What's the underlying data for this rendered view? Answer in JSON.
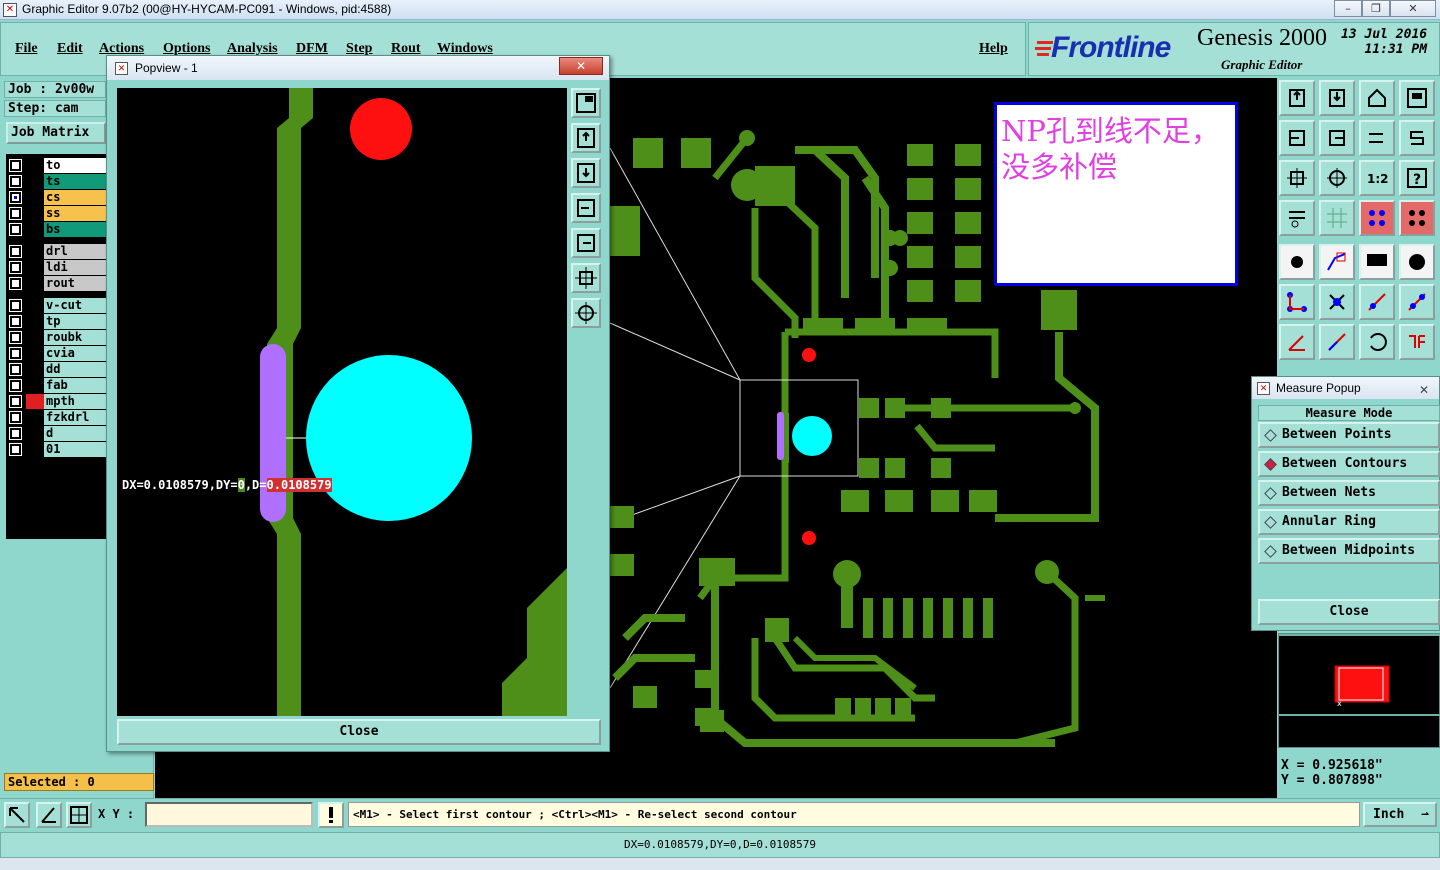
{
  "window": {
    "title": "Graphic Editor 9.07b2 (00@HY-HYCAM-PC091 - Windows, pid:4588)",
    "min_label": "–",
    "max_label": "❐",
    "close_label": "✕"
  },
  "menu": {
    "items": [
      "File",
      "Edit",
      "Actions",
      "Options",
      "Analysis",
      "DFM",
      "Step",
      "Rout",
      "Windows"
    ],
    "help": "Help"
  },
  "brand": {
    "logo": "Frontline",
    "product": "Genesis 2000",
    "subtitle": "Graphic Editor",
    "date": "13 Jul 2016",
    "time": "11:31 PM"
  },
  "job": {
    "job_label": "Job : 2v00w",
    "step_label": "Step: cam",
    "matrix_button": "Job Matrix"
  },
  "layers": [
    {
      "name": "to",
      "color": "#ffffff",
      "checked": false,
      "group": 0
    },
    {
      "name": "ts",
      "color": "#109a7a",
      "checked": false,
      "group": 0
    },
    {
      "name": "cs",
      "color": "#f6c24d",
      "checked": true,
      "group": 0
    },
    {
      "name": "ss",
      "color": "#f6c24d",
      "checked": false,
      "group": 0
    },
    {
      "name": "bs",
      "color": "#109a7a",
      "checked": false,
      "group": 0
    },
    {
      "name": "drl",
      "color": "#c8c8c8",
      "checked": false,
      "group": 1
    },
    {
      "name": "ldi",
      "color": "#c8c8c8",
      "checked": false,
      "group": 1
    },
    {
      "name": "rout",
      "color": "#c8c8c8",
      "checked": false,
      "group": 1
    },
    {
      "name": "v-cut",
      "color": "#a5e0d7",
      "checked": false,
      "group": 2
    },
    {
      "name": "tp",
      "color": "#a5e0d7",
      "checked": false,
      "group": 2
    },
    {
      "name": "roubk",
      "color": "#a5e0d7",
      "checked": false,
      "group": 2
    },
    {
      "name": "cvia",
      "color": "#a5e0d7",
      "checked": false,
      "group": 2
    },
    {
      "name": "dd",
      "color": "#a5e0d7",
      "checked": false,
      "group": 2
    },
    {
      "name": "fab",
      "color": "#a5e0d7",
      "checked": false,
      "group": 2
    },
    {
      "name": "mpth",
      "color": "#a5e0d7",
      "checked": false,
      "group": 2,
      "swatch": "#e02020"
    },
    {
      "name": "fzkdrl",
      "color": "#a5e0d7",
      "checked": false,
      "group": 2
    },
    {
      "name": "d",
      "color": "#a5e0d7",
      "checked": false,
      "group": 2
    },
    {
      "name": "01",
      "color": "#a5e0d7",
      "checked": false,
      "group": 2
    }
  ],
  "selected": "Selected : 0",
  "note": {
    "text": "NP孔到线不足，没多补偿"
  },
  "popview": {
    "title": "Popview - 1",
    "close_x": "✕",
    "close_button": "Close",
    "measure_prefix": "DX=0.0108579,DY=",
    "measure_dy": "0",
    "measure_mid": ",D=",
    "measure_d": "0.0108579"
  },
  "measure_popup": {
    "title": "Measure Popup",
    "close_x": "✕",
    "mode_label": "Measure Mode",
    "options": [
      {
        "label": "Between Points",
        "selected": false
      },
      {
        "label": "Between Contours",
        "selected": true
      },
      {
        "label": "Between Nets",
        "selected": false
      },
      {
        "label": "Annular Ring",
        "selected": false
      },
      {
        "label": "Between Midpoints",
        "selected": false
      }
    ],
    "close_button": "Close"
  },
  "coords": {
    "x": "X = 0.925618\"",
    "y": "Y = 0.807898\""
  },
  "bottom": {
    "xy_label": "X Y :",
    "xy_value": "",
    "prompt": "<M1> - Select first contour ; <Ctrl><M1> - Re-select second contour",
    "unit": "Inch",
    "status": "DX=0.0108579,DY=0,D=0.0108579"
  },
  "colors": {
    "background": "#8fd6cc",
    "panel": "#a5e0d7",
    "copper": "#4e8f1a",
    "hole": "#00ffff",
    "np_hole": "#ff1010",
    "measure_line": "#b070ff"
  }
}
